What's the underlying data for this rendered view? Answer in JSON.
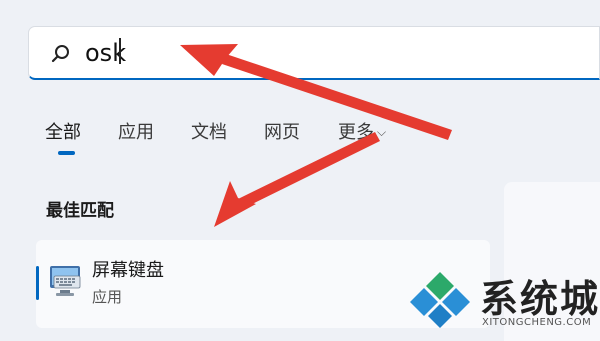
{
  "search": {
    "value": "osk"
  },
  "tabs": [
    {
      "label": "全部",
      "active": true
    },
    {
      "label": "应用",
      "active": false
    },
    {
      "label": "文档",
      "active": false
    },
    {
      "label": "网页",
      "active": false
    },
    {
      "label": "更多",
      "active": false
    }
  ],
  "best_match": {
    "heading": "最佳匹配",
    "result": {
      "title": "屏幕键盘",
      "subtitle": "应用",
      "icon": "on-screen-keyboard-icon"
    }
  },
  "watermark": {
    "name": "系统城",
    "url": "XITONGCHENG.COM"
  },
  "colors": {
    "accent": "#0067c0",
    "arrow": "#e53b30"
  }
}
